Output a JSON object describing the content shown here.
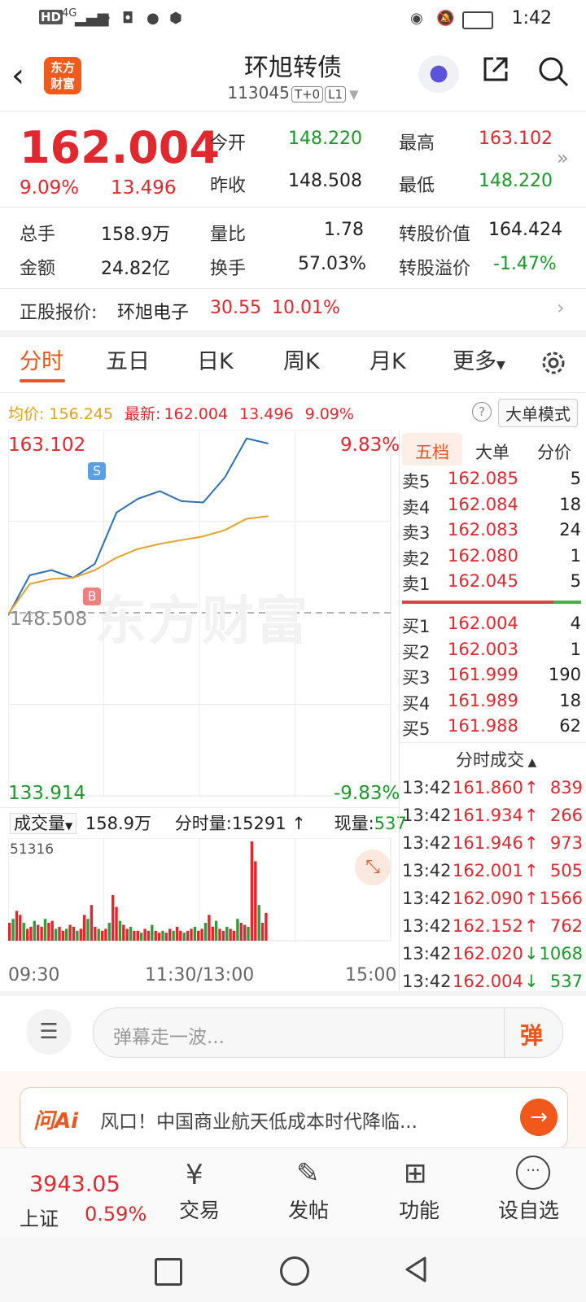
{
  "status_bar": {
    "signal": "4G",
    "time": "1:42"
  },
  "header": {
    "back_label": "<",
    "logo_text": "东方\n财富",
    "title": "环旭转债",
    "code": "113045",
    "badge1": "T+0",
    "badge2": "L1"
  },
  "quote": {
    "price": "162.004",
    "change_pct": "9.09%",
    "change": "13.496",
    "open_label": "今开",
    "open": "148.220",
    "prev_label": "昨收",
    "prev": "148.508",
    "high_label": "最高",
    "high": "163.102",
    "low_label": "最低",
    "low": "148.220",
    "vol_label": "总手",
    "vol": "158.9万",
    "amt_label": "金额",
    "amt": "24.82亿",
    "vr_label": "量比",
    "vr": "1.78",
    "turn_label": "换手",
    "turn": "57.03%",
    "conv_label": "转股价值",
    "conv": "164.424",
    "prem_label": "转股溢价",
    "prem": "-1.47%"
  },
  "underlying": {
    "label": "正股报价:",
    "name": "环旭电子",
    "price": "30.55",
    "pct": "10.01%"
  },
  "tabs": [
    "分时",
    "五日",
    "日K",
    "周K",
    "月K",
    "更多"
  ],
  "chart_info": {
    "avg_label": "均价:",
    "avg": "156.245",
    "latest_label": "最新:",
    "latest": "162.004",
    "chg": "13.496",
    "pct": "9.09%",
    "mode_button": "大单模式"
  },
  "chart_labels": {
    "top_price": "163.102",
    "top_pct": "9.83%",
    "mid_price": "148.508",
    "bottom_price": "133.914",
    "bottom_pct": "-9.83%",
    "marker_s": "S",
    "marker_b": "B",
    "watermark": "东方财富"
  },
  "volume_bar": {
    "label": "成交量",
    "total": "158.9万",
    "tick_label": "分时量:",
    "tick_value": "15291",
    "now_label": "现量:",
    "now_value": "537",
    "max": "51316"
  },
  "time_axis": [
    "09:30",
    "11:30/13:00",
    "15:00"
  ],
  "chart_data": {
    "type": "line",
    "x": [
      "09:30",
      "09:45",
      "10:00",
      "10:15",
      "10:30",
      "10:45",
      "11:00",
      "11:15",
      "11:30",
      "13:15",
      "13:30",
      "13:45",
      "13:55"
    ],
    "series": [
      {
        "values": [
          148.3,
          151.5,
          151.9,
          151.3,
          152.4,
          156.5,
          157.6,
          158.2,
          157.4,
          157.3,
          159.3,
          162.4,
          162.0
        ]
      },
      {
        "values": [
          148.4,
          150.8,
          151.2,
          151.3,
          151.9,
          152.9,
          153.6,
          154.0,
          154.3,
          154.6,
          155.1,
          156.0,
          156.2
        ]
      }
    ],
    "ylim": [
      133.914,
      163.102
    ],
    "volume": [
      18,
      22,
      30,
      26,
      18,
      12,
      14,
      20,
      16,
      14,
      22,
      18,
      20,
      12,
      14,
      10,
      12,
      16,
      14,
      10,
      12,
      26,
      22,
      36,
      14,
      12,
      10,
      12,
      18,
      46,
      34,
      20,
      16,
      12,
      14,
      10,
      10,
      8,
      12,
      10,
      16,
      10,
      8,
      10,
      8,
      12,
      10,
      14,
      10,
      8,
      10,
      12,
      14,
      10,
      12,
      18,
      26,
      14,
      20,
      12,
      10,
      14,
      12,
      10,
      22,
      18,
      16,
      14,
      100,
      80,
      36,
      18,
      28
    ]
  },
  "order_book": {
    "tabs": [
      "五档",
      "大单",
      "分价"
    ],
    "asks": [
      {
        "label": "卖5",
        "price": "162.085",
        "vol": "5"
      },
      {
        "label": "卖4",
        "price": "162.084",
        "vol": "18"
      },
      {
        "label": "卖3",
        "price": "162.083",
        "vol": "24"
      },
      {
        "label": "卖2",
        "price": "162.080",
        "vol": "1"
      },
      {
        "label": "卖1",
        "price": "162.045",
        "vol": "5"
      }
    ],
    "bids": [
      {
        "label": "买1",
        "price": "162.004",
        "vol": "4"
      },
      {
        "label": "买2",
        "price": "162.003",
        "vol": "1"
      },
      {
        "label": "买3",
        "price": "161.999",
        "vol": "190"
      },
      {
        "label": "买4",
        "price": "161.989",
        "vol": "18"
      },
      {
        "label": "买5",
        "price": "161.988",
        "vol": "62"
      }
    ]
  },
  "ticks": {
    "title": "分时成交",
    "rows": [
      {
        "time": "13:42",
        "price": "161.860",
        "dir": "↑",
        "vol": "839",
        "up": true
      },
      {
        "time": "13:42",
        "price": "161.934",
        "dir": "↑",
        "vol": "266",
        "up": true
      },
      {
        "time": "13:42",
        "price": "161.946",
        "dir": "↑",
        "vol": "973",
        "up": true
      },
      {
        "time": "13:42",
        "price": "162.001",
        "dir": "↑",
        "vol": "505",
        "up": true
      },
      {
        "time": "13:42",
        "price": "162.090",
        "dir": "↑",
        "vol": "1566",
        "up": true
      },
      {
        "time": "13:42",
        "price": "162.152",
        "dir": "↑",
        "vol": "762",
        "up": true
      },
      {
        "time": "13:42",
        "price": "162.020",
        "dir": "↓",
        "vol": "1068",
        "up": false
      },
      {
        "time": "13:42",
        "price": "162.004",
        "dir": "↓",
        "vol": "537",
        "up": false
      }
    ]
  },
  "comment": {
    "placeholder": "弹幕走一波...",
    "danmu": "弹"
  },
  "ai_banner": {
    "logo": "问Ai",
    "text": "风口！中国商业航天低成本时代降临..."
  },
  "bottom_nav": {
    "index_value": "3943.05",
    "index_name": "上证",
    "index_pct": "0.59%",
    "items": [
      "交易",
      "发帖",
      "功能",
      "设自选"
    ]
  }
}
